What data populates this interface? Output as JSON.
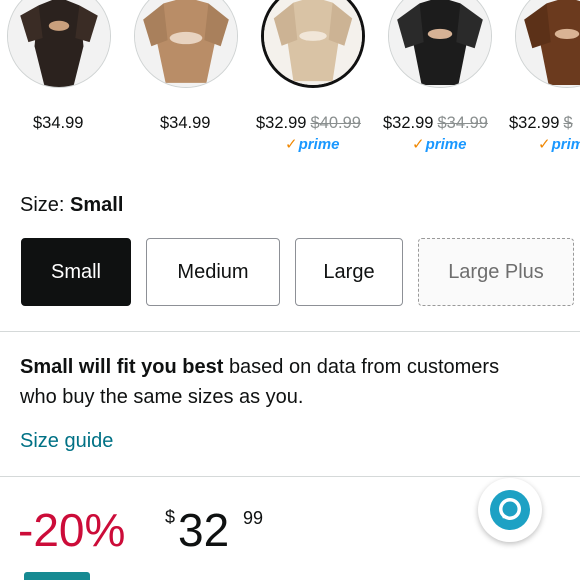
{
  "swatches": [
    {
      "price": "$34.99",
      "was": "",
      "prime": false,
      "selected": false
    },
    {
      "price": "$34.99",
      "was": "",
      "prime": false,
      "selected": false
    },
    {
      "price": "$32.99",
      "was": "$40.99",
      "prime": true,
      "selected": true
    },
    {
      "price": "$32.99",
      "was": "$34.99",
      "prime": true,
      "selected": false
    },
    {
      "price": "$32.99",
      "was": "$",
      "prime": true,
      "selected": false
    }
  ],
  "prime_label": "prime",
  "size": {
    "label_prefix": "Size:",
    "selected_value": "Small",
    "options": [
      "Small",
      "Medium",
      "Large",
      "Large Plus"
    ]
  },
  "fit": {
    "bold": "Small will fit you best",
    "rest": "based on data from customers who buy the same sizes as you."
  },
  "size_guide_link": "Size guide",
  "price": {
    "discount": "-20%",
    "currency": "$",
    "whole": "32",
    "fraction": "99"
  },
  "colors": {
    "accent_link": "#007185",
    "discount": "#cc0c39",
    "prime": "#1a98ff",
    "alexa": "#1da1c4"
  },
  "icons": {
    "alexa": "alexa-icon",
    "prime_check": "check-icon"
  }
}
